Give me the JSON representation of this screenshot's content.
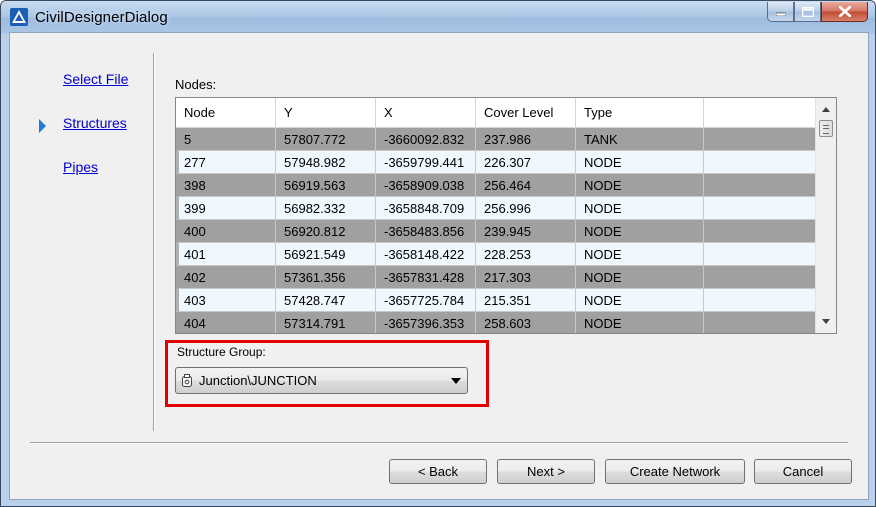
{
  "window": {
    "title": "CivilDesignerDialog"
  },
  "nav": {
    "items": [
      "Select File",
      "Structures",
      "Pipes"
    ],
    "active": "Structures"
  },
  "nodes": {
    "label": "Nodes:",
    "columns": [
      "Node",
      "Y",
      "X",
      "Cover Level",
      "Type"
    ],
    "rows": [
      [
        "5",
        "57807.772",
        "-3660092.832",
        "237.986",
        "TANK"
      ],
      [
        "277",
        "57948.982",
        "-3659799.441",
        "226.307",
        "NODE"
      ],
      [
        "398",
        "56919.563",
        "-3658909.038",
        "256.464",
        "NODE"
      ],
      [
        "399",
        "56982.332",
        "-3658848.709",
        "256.996",
        "NODE"
      ],
      [
        "400",
        "56920.812",
        "-3658483.856",
        "239.945",
        "NODE"
      ],
      [
        "401",
        "56921.549",
        "-3658148.422",
        "228.253",
        "NODE"
      ],
      [
        "402",
        "57361.356",
        "-3657831.428",
        "217.303",
        "NODE"
      ],
      [
        "403",
        "57428.747",
        "-3657725.784",
        "215.351",
        "NODE"
      ],
      [
        "404",
        "57314.791",
        "-3657396.353",
        "258.603",
        "NODE"
      ]
    ]
  },
  "structure_group": {
    "label": "Structure Group:",
    "value": "Junction\\JUNCTION"
  },
  "buttons": {
    "back": "< Back",
    "next": "Next >",
    "create": "Create Network",
    "cancel": "Cancel"
  },
  "colors": {
    "link": "#0000cc",
    "highlight_border": "#e00000",
    "row_dark": "#a0a0a0",
    "row_light": "#f0f8ff"
  },
  "icons": {
    "app": "civil-designer-app-icon",
    "minimize": "minimize-icon",
    "maximize": "maximize-icon",
    "close": "close-icon",
    "active_nav": "arrow-right-icon",
    "combo_item": "structure-icon",
    "dropdown": "chevron-down-icon"
  }
}
